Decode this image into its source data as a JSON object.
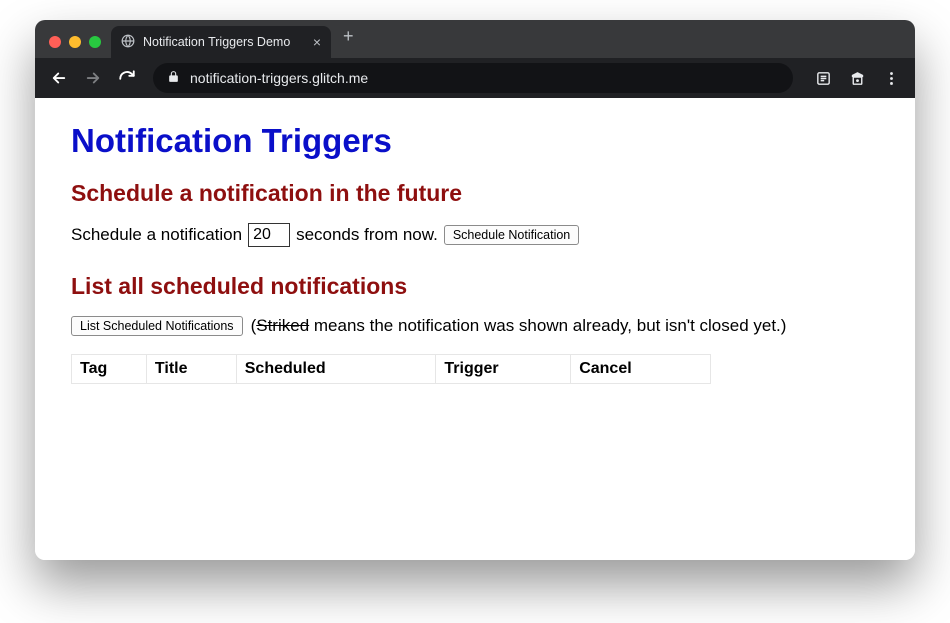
{
  "browser": {
    "tab_title": "Notification Triggers Demo",
    "url": "notification-triggers.glitch.me"
  },
  "page": {
    "h1": "Notification Triggers",
    "schedule": {
      "heading": "Schedule a notification in the future",
      "pre_text": "Schedule a notification",
      "seconds_value": "20",
      "post_text": "seconds from now.",
      "button_label": "Schedule Notification"
    },
    "list": {
      "heading": "List all scheduled notifications",
      "button_label": "List Scheduled Notifications",
      "paren_open": "(",
      "striked_word": "Striked",
      "hint_rest": " means the notification was shown already, but isn't closed yet.)"
    },
    "table": {
      "headers": [
        "Tag",
        "Title",
        "Scheduled",
        "Trigger",
        "Cancel"
      ],
      "rows": []
    }
  }
}
